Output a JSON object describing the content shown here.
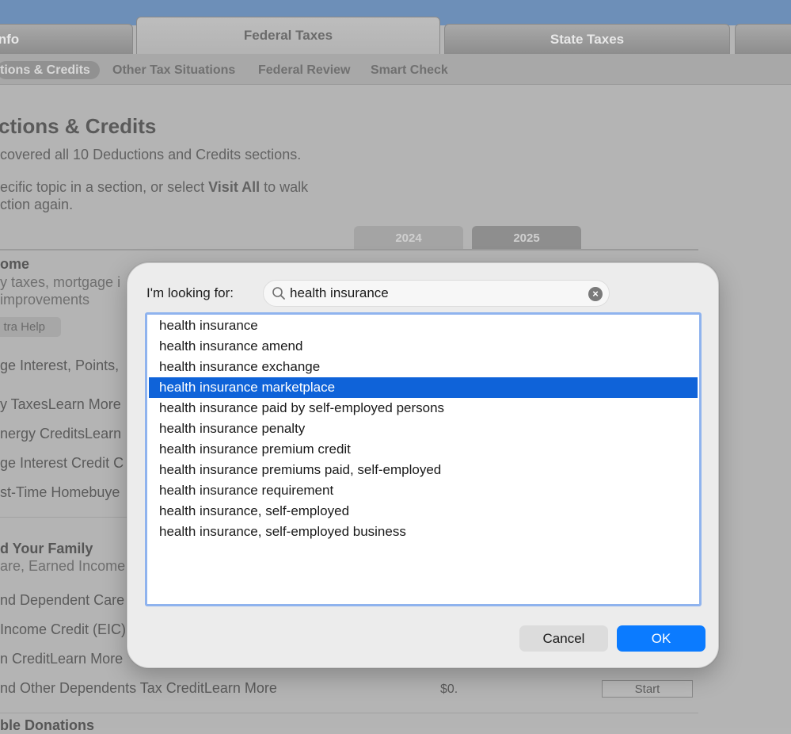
{
  "main_tabs": [
    {
      "label": "Info"
    },
    {
      "label": "Federal Taxes"
    },
    {
      "label": "State Taxes"
    }
  ],
  "subnav": [
    {
      "label": "tions & Credits"
    },
    {
      "label": "Other Tax Situations"
    },
    {
      "label": "Federal Review"
    },
    {
      "label": "Smart Check"
    }
  ],
  "background": {
    "title": "ctions & Credits",
    "covered": "covered all 10 Deductions and Credits sections.",
    "instruction_line1_pre": "ecific topic in a section, or select ",
    "instruction_line1_bold": "Visit All",
    "instruction_line1_post": " to walk",
    "instruction_line2": "ction again.",
    "year_tabs": [
      "2024",
      "2025"
    ],
    "home_heading": "ome",
    "home_sub1": "y taxes, mortgage i",
    "home_sub2": "improvements",
    "extra_help": "tra Help",
    "rows": [
      {
        "text": "ge Interest, Points,",
        "link": ""
      },
      {
        "text": "y Taxes",
        "link": "Learn More"
      },
      {
        "text": "nergy Credits",
        "link": "Learn"
      },
      {
        "text": "ge Interest Credit C",
        "link": ""
      },
      {
        "text": "st-Time Homebuye",
        "link": ""
      }
    ],
    "family_heading": "d Your Family",
    "family_sub": "are, Earned Income",
    "family_rows": [
      {
        "text": "nd Dependent Care",
        "link": ""
      },
      {
        "text": "Income Credit (EIC)",
        "link": ""
      },
      {
        "text": "n Credit",
        "link": "Learn More"
      },
      {
        "text": "nd Other Dependents Tax Credit",
        "link": "Learn More",
        "amount": "$0.",
        "button": "Start"
      }
    ],
    "donations_heading": "ble Donations"
  },
  "dialog": {
    "label": "I'm looking for:",
    "search_value": "health insurance",
    "results": [
      "health insurance",
      "health insurance amend",
      "health insurance exchange",
      "health insurance marketplace",
      "health insurance paid by self-employed persons",
      "health insurance penalty",
      "health insurance premium credit",
      "health insurance premiums paid, self-employed",
      "health insurance requirement",
      "health insurance, self-employed",
      "health insurance, self-employed business"
    ],
    "selected_index": 3,
    "cancel_label": "Cancel",
    "ok_label": "OK"
  },
  "colors": {
    "accent": "#0b7bff",
    "selection": "#0f63d9",
    "focus_ring": "#8fb3ee",
    "top_band": "#6d8fb8"
  }
}
